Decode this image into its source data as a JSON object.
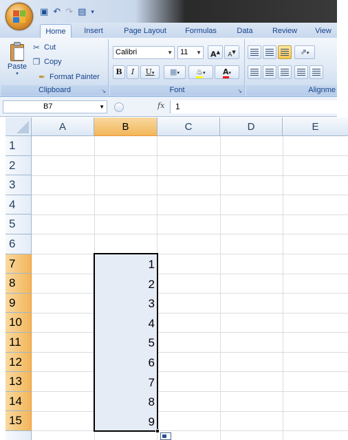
{
  "quick_access": {
    "icons": [
      "save-icon",
      "undo-icon",
      "redo-icon",
      "print-preview-icon",
      "customize-icon"
    ]
  },
  "ribbon": {
    "tabs": [
      {
        "label": "Home",
        "active": true
      },
      {
        "label": "Insert"
      },
      {
        "label": "Page Layout"
      },
      {
        "label": "Formulas"
      },
      {
        "label": "Data"
      },
      {
        "label": "Review"
      },
      {
        "label": "View"
      }
    ],
    "clipboard": {
      "group_label": "Clipboard",
      "paste_label": "Paste",
      "cut_label": "Cut",
      "copy_label": "Copy",
      "format_painter_label": "Format Painter"
    },
    "font": {
      "group_label": "Font",
      "font_name": "Calibri",
      "font_size": "11",
      "grow_label": "A",
      "shrink_label": "A",
      "bold_label": "B",
      "italic_label": "I",
      "underline_label": "U",
      "font_color_label": "A",
      "fill_color": "#ffff00",
      "font_color": "#ff0000"
    },
    "alignment": {
      "group_label": "Alignme"
    }
  },
  "formula_bar": {
    "name_box": "B7",
    "fx_label": "fx",
    "formula": "1"
  },
  "sheet": {
    "columns": [
      "A",
      "B",
      "C",
      "D",
      "E"
    ],
    "selected_column": "B",
    "rows": [
      "1",
      "2",
      "3",
      "4",
      "5",
      "6",
      "7",
      "8",
      "9",
      "10",
      "11",
      "12",
      "13",
      "14",
      "15"
    ],
    "selected_rows": [
      "7",
      "8",
      "9",
      "10",
      "11",
      "12",
      "13",
      "14",
      "15"
    ],
    "column_b_values": [
      "1",
      "2",
      "3",
      "4",
      "5",
      "6",
      "7",
      "8",
      "9"
    ],
    "accent": "#f2b65a"
  }
}
